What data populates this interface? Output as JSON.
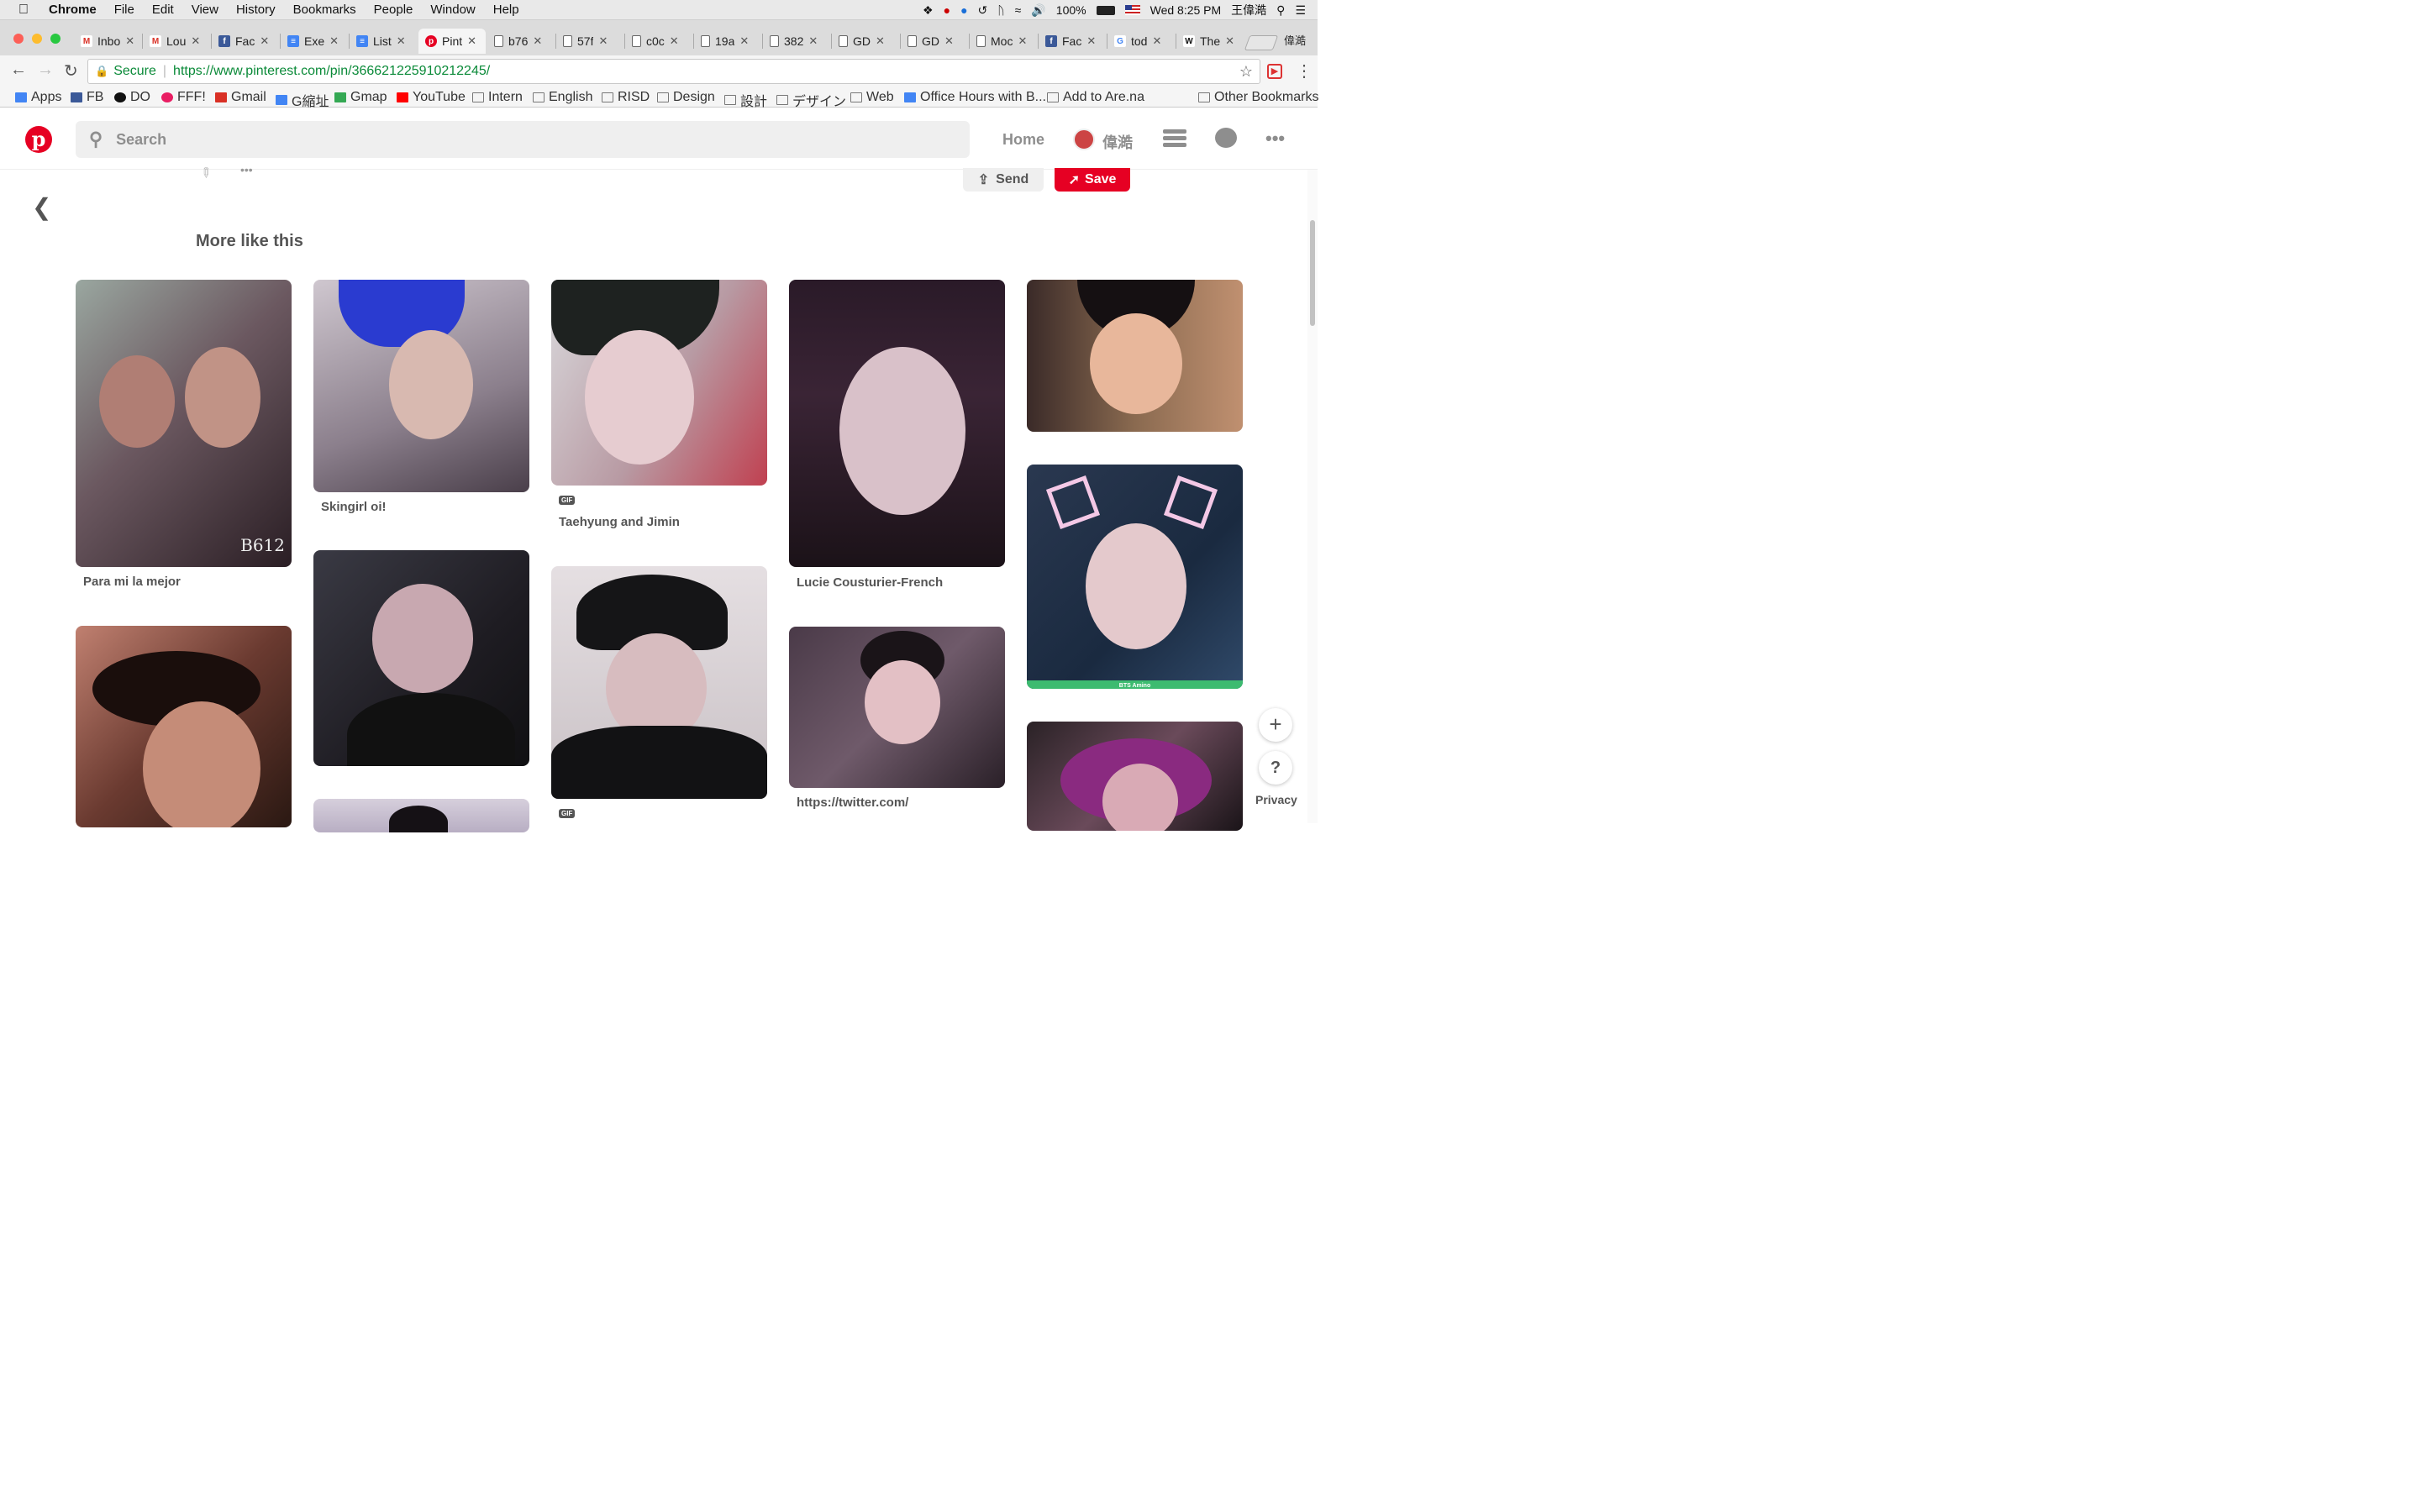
{
  "menubar": {
    "app": "Chrome",
    "items": [
      "File",
      "Edit",
      "View",
      "History",
      "Bookmarks",
      "People",
      "Window",
      "Help"
    ],
    "battery": "100%",
    "clock": "Wed 8:25 PM",
    "user": "王偉澔"
  },
  "tabs": [
    {
      "label": "Inbo",
      "icon": "gmail-icon"
    },
    {
      "label": "Lou",
      "icon": "gmail-icon"
    },
    {
      "label": "Fac",
      "icon": "facebook-icon"
    },
    {
      "label": "Exe",
      "icon": "docs-icon"
    },
    {
      "label": "List",
      "icon": "docs-icon"
    },
    {
      "label": "Pint",
      "icon": "pinterest-icon",
      "active": true
    },
    {
      "label": "b76",
      "icon": "page-icon"
    },
    {
      "label": "57f",
      "icon": "page-icon"
    },
    {
      "label": "c0c",
      "icon": "page-icon"
    },
    {
      "label": "19a",
      "icon": "page-icon"
    },
    {
      "label": "382",
      "icon": "page-icon"
    },
    {
      "label": "GD",
      "icon": "page-icon"
    },
    {
      "label": "GD",
      "icon": "page-icon"
    },
    {
      "label": "Moc",
      "icon": "page-icon"
    },
    {
      "label": "Fac",
      "icon": "facebook-icon"
    },
    {
      "label": "tod",
      "icon": "google-icon"
    },
    {
      "label": "The",
      "icon": "wikipedia-icon"
    }
  ],
  "profile_name": "偉澔",
  "address": {
    "secure_label": "Secure",
    "url": "https://www.pinterest.com/pin/366621225910212245/"
  },
  "bookmarks": [
    {
      "label": "Apps"
    },
    {
      "label": "FB"
    },
    {
      "label": "DO"
    },
    {
      "label": "FFF!"
    },
    {
      "label": "Gmail"
    },
    {
      "label": "G縮址"
    },
    {
      "label": "Gmap"
    },
    {
      "label": "YouTube"
    },
    {
      "label": "Intern"
    },
    {
      "label": "English"
    },
    {
      "label": "RISD"
    },
    {
      "label": "Design"
    },
    {
      "label": "設計"
    },
    {
      "label": "デザイン"
    },
    {
      "label": "Web"
    },
    {
      "label": "Office Hours with B..."
    },
    {
      "label": "Add to Are.na"
    }
  ],
  "other_bookmarks": "Other Bookmarks",
  "pinterest": {
    "search_placeholder": "Search",
    "home": "Home",
    "user_name": "偉澔",
    "send": "Send",
    "save": "Save",
    "section_title": "More like this",
    "privacy": "Privacy",
    "pins": [
      {
        "caption": "Para mi la mejor",
        "watermark": "B612",
        "bg": "#8b6f78"
      },
      {
        "caption": "Skingirl oi!",
        "bg": "#8e7f8f"
      },
      {
        "caption": "Taehyung and Jimin",
        "gif": "GIF",
        "bg": "#a88f95"
      },
      {
        "caption": "Lucie Cousturier-French",
        "bg": "#5a4050"
      },
      {
        "caption": "",
        "bg": "#7a4a3a"
      },
      {
        "caption": "",
        "watermark": "BTS Amino",
        "bg": "#345"
      },
      {
        "caption": "https://twitter.com/",
        "bg": "#5b4a5a"
      },
      {
        "caption": "",
        "gif": "GIF",
        "bg": "#cfc6cb"
      }
    ]
  }
}
